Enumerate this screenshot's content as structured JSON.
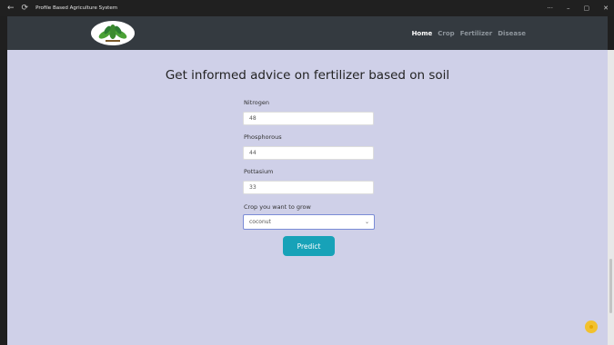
{
  "window": {
    "title": "Profile Based Agriculture System",
    "back_icon": "arrow-left-icon",
    "refresh_icon": "refresh-icon",
    "controls": [
      "more-icon",
      "minimize-icon",
      "maximize-icon",
      "close-icon"
    ]
  },
  "nav": {
    "logo_icon": "leaf-logo-icon",
    "links": [
      {
        "label": "Home",
        "active": true
      },
      {
        "label": "Crop",
        "active": false
      },
      {
        "label": "Fertilizer",
        "active": false
      },
      {
        "label": "Disease",
        "active": false
      }
    ]
  },
  "page": {
    "heading": "Get informed advice on fertilizer based on soil"
  },
  "form": {
    "nitrogen": {
      "label": "Nitrogen",
      "value": "48"
    },
    "phosphorous": {
      "label": "Phosphorous",
      "value": "44"
    },
    "pottasium": {
      "label": "Pottasium",
      "value": "33"
    },
    "crop": {
      "label": "Crop you want to grow",
      "value": "coconut"
    },
    "submit_label": "Predict"
  },
  "colors": {
    "navbar": "#343a40",
    "background": "#cfd0e8",
    "button": "#17a2b8",
    "fab": "#f2c12e"
  }
}
